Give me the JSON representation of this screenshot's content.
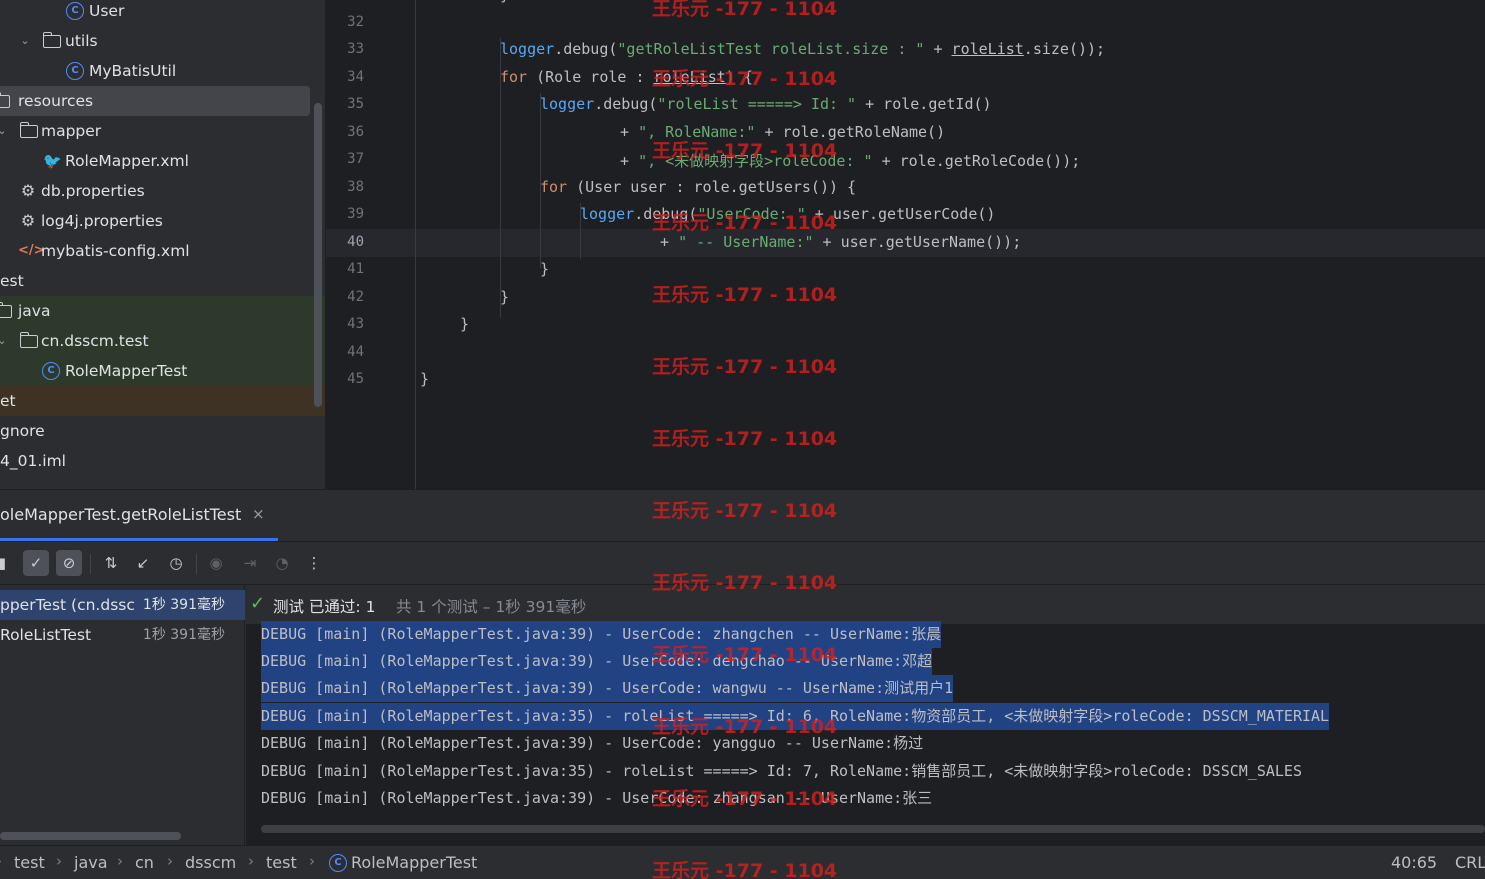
{
  "project_tree": {
    "items": [
      {
        "label": "User",
        "icon": "class-icon"
      },
      {
        "label": "utils",
        "icon": "package-icon"
      },
      {
        "label": "MyBatisUtil",
        "icon": "class-icon"
      },
      {
        "label": "resources",
        "icon": "resources-folder-icon"
      },
      {
        "label": "mapper",
        "icon": "folder-icon"
      },
      {
        "label": "RoleMapper.xml",
        "icon": "mybatis-mapper-icon"
      },
      {
        "label": "db.properties",
        "icon": "properties-icon"
      },
      {
        "label": "log4j.properties",
        "icon": "properties-icon"
      },
      {
        "label": "mybatis-config.xml",
        "icon": "xml-icon"
      },
      {
        "label": "est"
      },
      {
        "label": "java",
        "icon": "test-folder-icon"
      },
      {
        "label": "cn.dsscm.test",
        "icon": "package-icon"
      },
      {
        "label": "RoleMapperTest",
        "icon": "class-icon"
      },
      {
        "label": "et"
      },
      {
        "label": "gnore"
      },
      {
        "label": "4_01.iml"
      }
    ]
  },
  "editor": {
    "line_numbers": [
      "32",
      "33",
      "34",
      "35",
      "36",
      "37",
      "38",
      "39",
      "40",
      "41",
      "42",
      "43",
      "44",
      "45"
    ],
    "current_line": "40",
    "code": {
      "l32": "}",
      "l33_logger": "logger",
      "l33_debug": ".debug(",
      "l33_str": "\"getRoleListTest roleList.size : \"",
      "l33_plus": " + ",
      "l33_var": "roleList",
      "l33_rest": ".size());",
      "l34_for": "for",
      "l34_mid": " (Role role : ",
      "l34_var": "roleList",
      "l34_rest": ") {",
      "l35_logger": "logger",
      "l35_debug": ".debug(",
      "l35_str": "\"roleList =====> Id: \"",
      "l35_rest": " + role.getId()",
      "l36_plus": "+ ",
      "l36_str": "\", RoleName:\"",
      "l36_rest": " + role.getRoleName()",
      "l37_plus": "+ ",
      "l37_str": "\", <未做映射字段>roleCode: \"",
      "l37_rest": " + role.getRoleCode());",
      "l38_for": "for",
      "l38_rest": " (User user : role.getUsers()) {",
      "l39_logger": "logger",
      "l39_debug": ".debug(",
      "l39_str": "\"UserCode: \"",
      "l39_rest": " + user.getUserCode()",
      "l40_plus": "+ ",
      "l40_str": "\" -- UserName:\"",
      "l40_rest": " + user.getUserName());",
      "l41": "}",
      "l42": "}",
      "l43": "}",
      "l45": "}"
    }
  },
  "run_window": {
    "tab_label": "oleMapperTest.getRoleListTest",
    "close_label": "×",
    "toolbar": [
      {
        "name": "stop-icon",
        "glyph": "■"
      },
      {
        "name": "show-passed-icon",
        "glyph": "✓"
      },
      {
        "name": "show-ignored-icon",
        "glyph": "⊘"
      },
      {
        "name": "sort-icon",
        "glyph": "⇅"
      },
      {
        "name": "collapse-icon",
        "glyph": "↙"
      },
      {
        "name": "history-icon",
        "glyph": "◷"
      },
      {
        "name": "screenshot-icon",
        "glyph": "◉"
      },
      {
        "name": "import-icon",
        "glyph": "⇥"
      },
      {
        "name": "coverage-icon",
        "glyph": "◔"
      },
      {
        "name": "more-icon",
        "glyph": "⋮"
      }
    ],
    "test_tree": [
      {
        "label": "pperTest (cn.dssc",
        "time": "1秒 391毫秒"
      },
      {
        "label": "RoleListTest",
        "time": "1秒 391毫秒"
      }
    ],
    "status": {
      "check": "✓",
      "passed": "测试 已通过: 1",
      "summary": "共 1 个测试 – 1秒 391毫秒"
    },
    "console_lines": [
      "DEBUG [main] (RoleMapperTest.java:39) - UserCode: zhangchen -- UserName:张晨",
      "DEBUG [main] (RoleMapperTest.java:39) - UserCode: dengchao -- UserName:邓超",
      "DEBUG [main] (RoleMapperTest.java:39) - UserCode: wangwu -- UserName:测试用户1",
      "DEBUG [main] (RoleMapperTest.java:35) - roleList =====> Id: 6, RoleName:物资部员工, <未做映射字段>roleCode: DSSCM_MATERIAL",
      "DEBUG [main] (RoleMapperTest.java:39) - UserCode: yangguo -- UserName:杨过",
      "DEBUG [main] (RoleMapperTest.java:35) - roleList =====> Id: 7, RoleName:销售部员工, <未做映射字段>roleCode: DSSCM_SALES",
      "DEBUG [main] (RoleMapperTest.java:39) - UserCode: zhangsan -- UserName:张三"
    ]
  },
  "navbar": {
    "crumbs": [
      "test",
      "java",
      "cn",
      "dsscm",
      "test",
      "RoleMapperTest"
    ],
    "separator": "›",
    "caret_position": "40:65",
    "line_separator": "CRL"
  },
  "watermark": "王乐元 -177 - 1104",
  "colors": {
    "accent": "#3574f0",
    "keyword": "#cf8e6d",
    "string": "#6aab73",
    "method": "#56a8f5",
    "watermark": "#d61f1f",
    "selection": "#214283"
  }
}
